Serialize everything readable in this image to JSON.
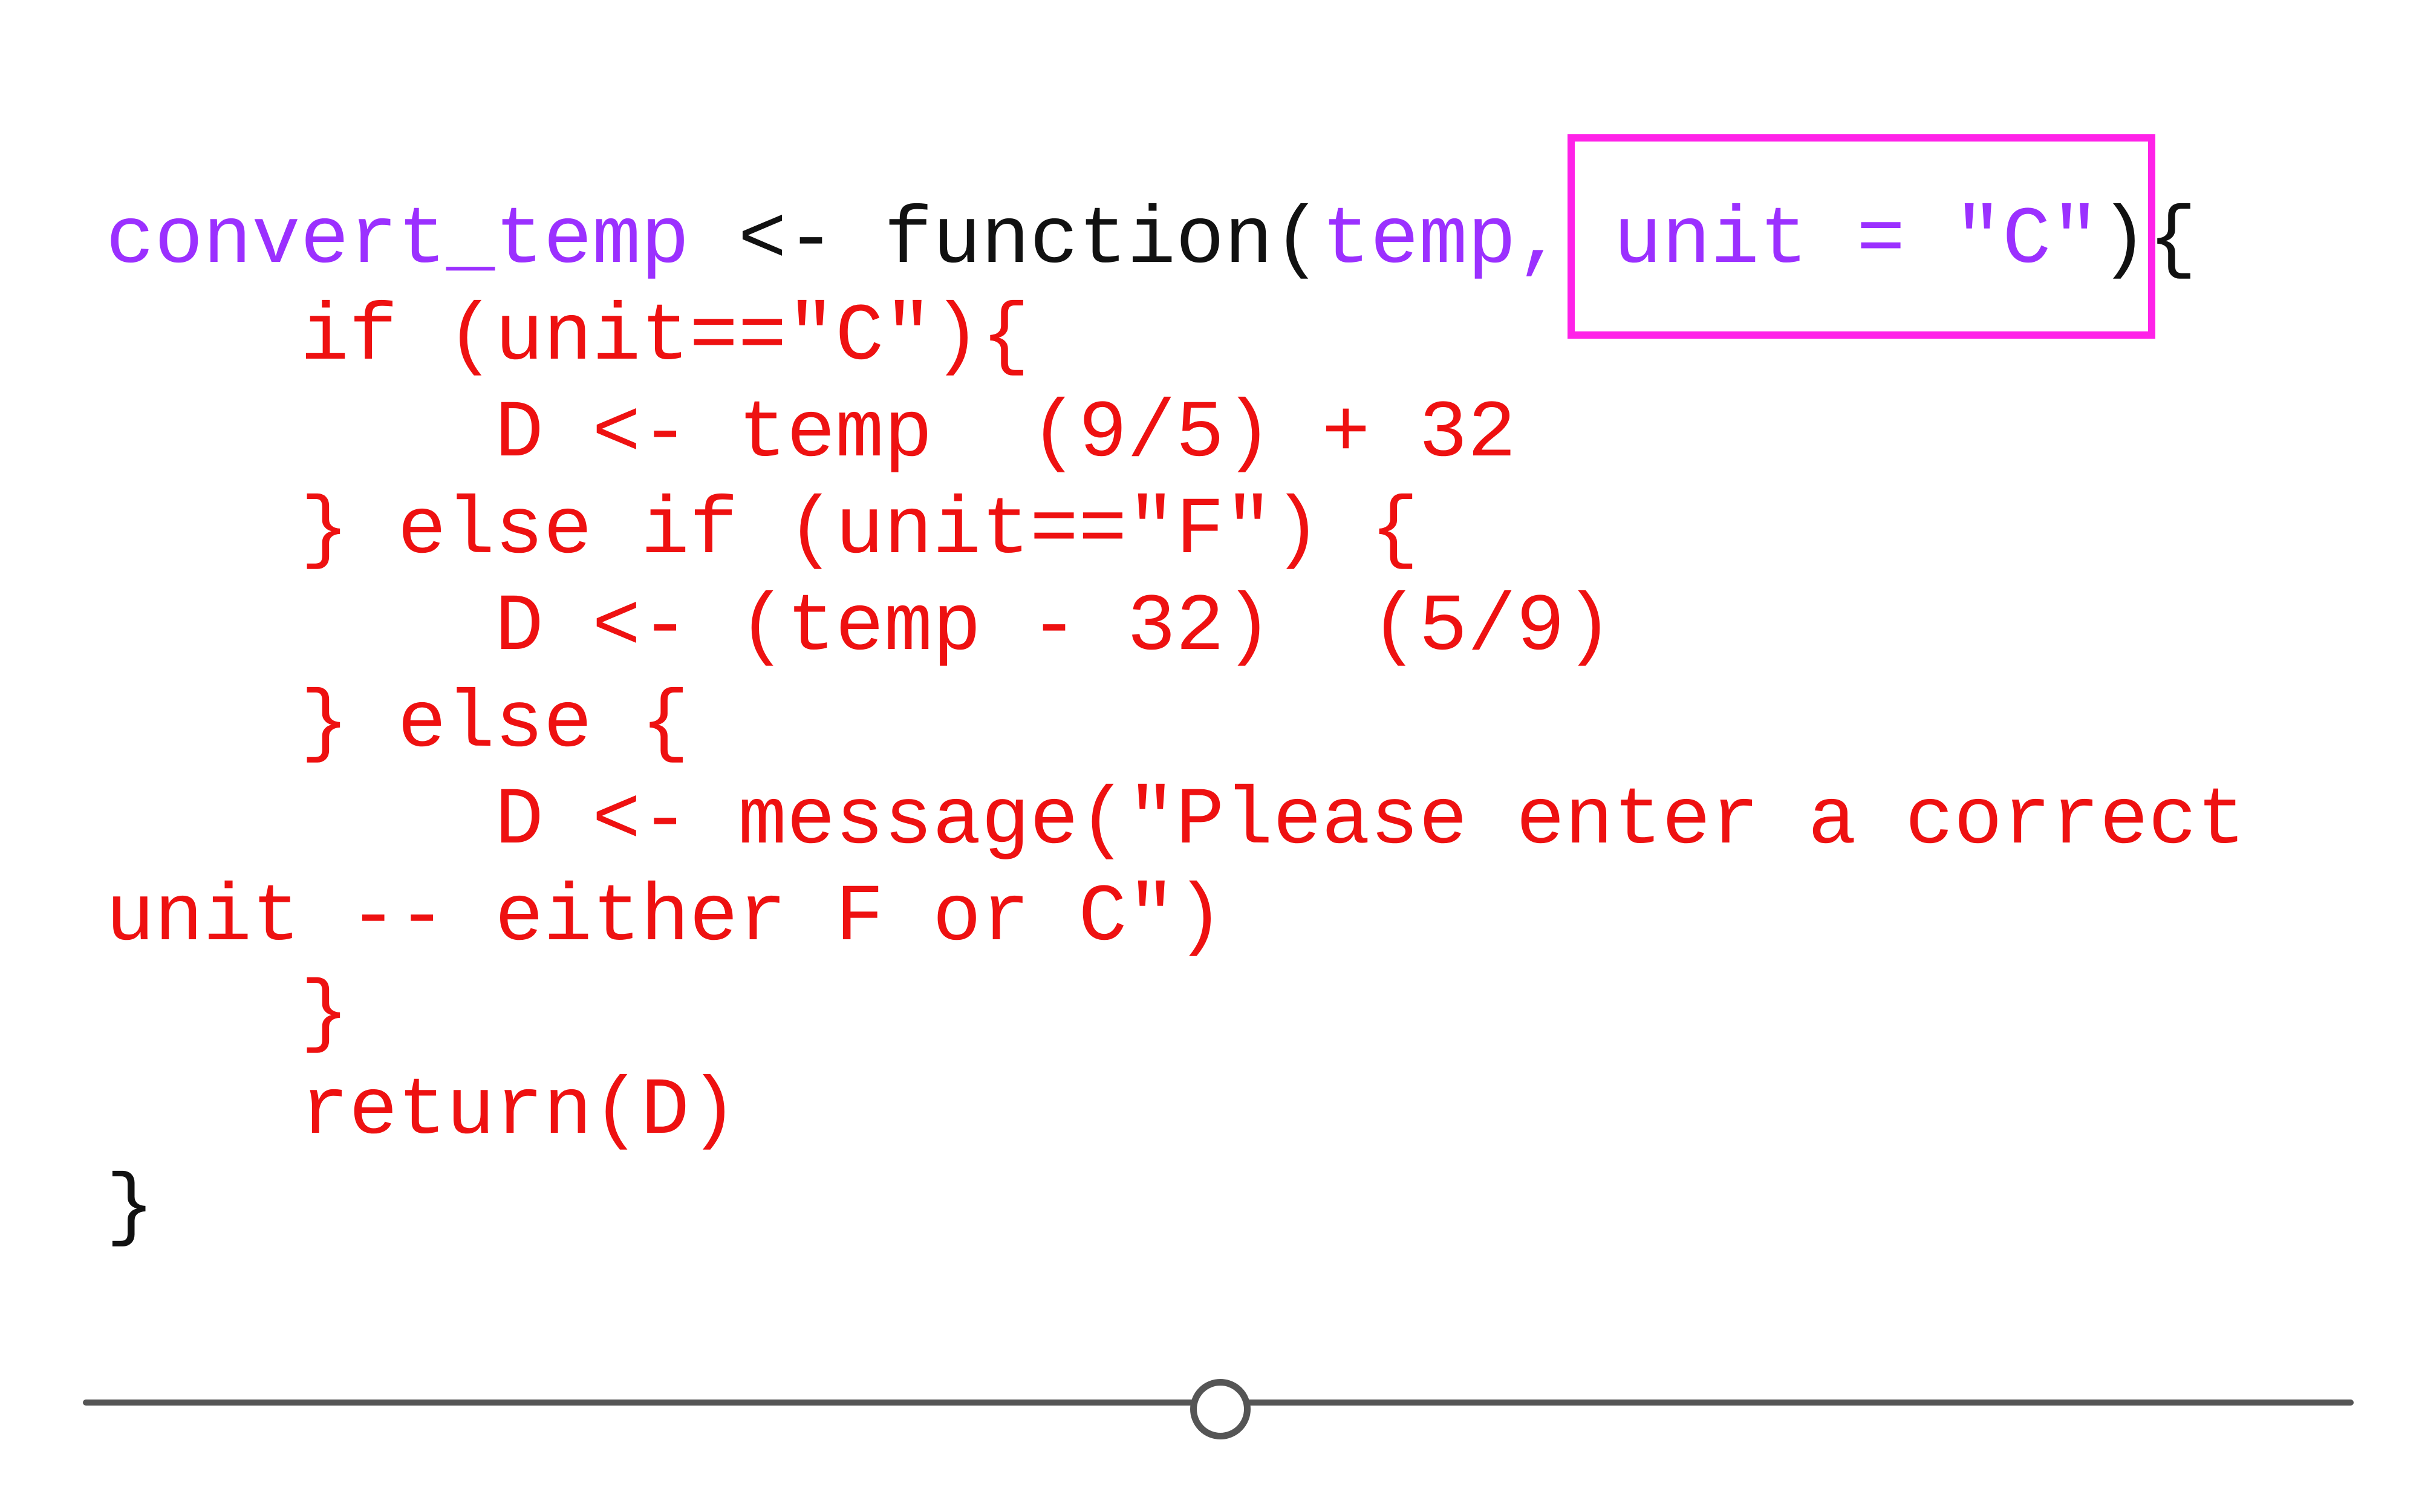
{
  "colors": {
    "argument": "#9b30ff",
    "plain": "#111111",
    "body": "#ee1111",
    "highlight": "#ff22e8",
    "slider": "#555555"
  },
  "code": {
    "lines": [
      [
        {
          "text": "convert_temp",
          "color": "argument"
        },
        {
          "text": " <- function(",
          "color": "plain"
        },
        {
          "text": "temp, unit = \"C\"",
          "color": "argument"
        },
        {
          "text": "){",
          "color": "plain"
        }
      ],
      [
        {
          "text": "    if (unit==\"C\"){",
          "color": "body"
        }
      ],
      [
        {
          "text": "        D <- temp  (9/5) + 32",
          "color": "body"
        }
      ],
      [
        {
          "text": "    } else if (unit==\"F\") {",
          "color": "body"
        }
      ],
      [
        {
          "text": "        D <- (temp - 32)  (5/9)",
          "color": "body"
        }
      ],
      [
        {
          "text": "    } else {",
          "color": "body"
        }
      ],
      [
        {
          "text": "        D <- message(\"Please enter a correct",
          "color": "body"
        }
      ],
      [
        {
          "text": "unit -- either F or C\")",
          "color": "body"
        }
      ],
      [
        {
          "text": "    }",
          "color": "body"
        }
      ],
      [
        {
          "text": "    return(D)",
          "color": "body"
        }
      ],
      [
        {
          "text": "}",
          "color": "plain"
        }
      ]
    ]
  },
  "slider": {
    "value": 0.5
  }
}
